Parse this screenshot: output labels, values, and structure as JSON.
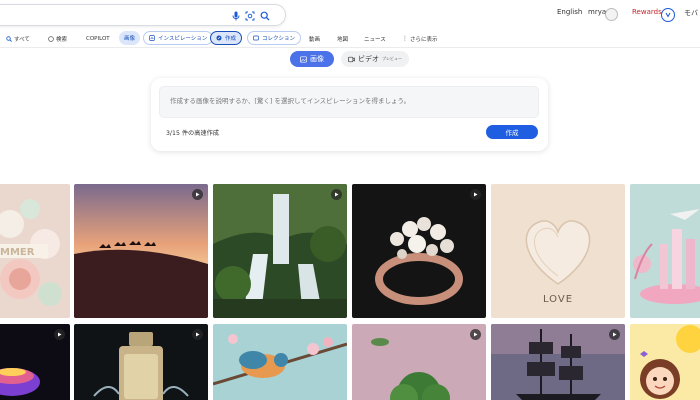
{
  "header": {
    "language": "English",
    "user_name": "mrya",
    "rewards_label": "Rewards",
    "more_label": "モバ"
  },
  "nav": {
    "items": [
      {
        "label": "すべて",
        "icon": "search-icon"
      },
      {
        "label": "検索",
        "icon": "chat-icon"
      },
      {
        "label": "COPILOT"
      },
      {
        "label": "画像"
      },
      {
        "label": "インスピレーション",
        "icon": "inspiration-icon"
      },
      {
        "label": "作成",
        "icon": "create-icon"
      },
      {
        "label": "コレクション",
        "icon": "collection-icon"
      },
      {
        "label": "動画"
      },
      {
        "label": "地図"
      },
      {
        "label": "ニュース"
      },
      {
        "label": "さらに表示",
        "icon": "more-icon"
      }
    ]
  },
  "mode_toggle": {
    "image_label": "画像",
    "video_label": "ビデオ",
    "preview_tag": "プレビュー"
  },
  "create_panel": {
    "prompt_placeholder": "作成する画像を説明するか、[驚く] を選択してインスピレーションを得ましょう。",
    "boost_text": "3/15 件の高速作成",
    "create_button": "作成"
  },
  "gallery": {
    "tiles": [
      {
        "subject": "paper flower collage with letters",
        "video": false
      },
      {
        "subject": "desert sunset with camels",
        "video": true
      },
      {
        "subject": "waterfall in forest",
        "video": true
      },
      {
        "subject": "rose gold pearl ring",
        "video": true
      },
      {
        "subject": "paper heart with LOVE",
        "video": false,
        "caption": "LOVE"
      },
      {
        "subject": "pink paper city with graduation cap",
        "video": false
      },
      {
        "subject": "glowing glass on dark",
        "video": true
      },
      {
        "subject": "perfume bottle splash",
        "video": true
      },
      {
        "subject": "bird on blossom branch",
        "video": false
      },
      {
        "subject": "floating island and tree",
        "video": true
      },
      {
        "subject": "pirate ship silhouette",
        "video": true
      },
      {
        "subject": "cartoon girl with sun",
        "video": false
      }
    ]
  }
}
